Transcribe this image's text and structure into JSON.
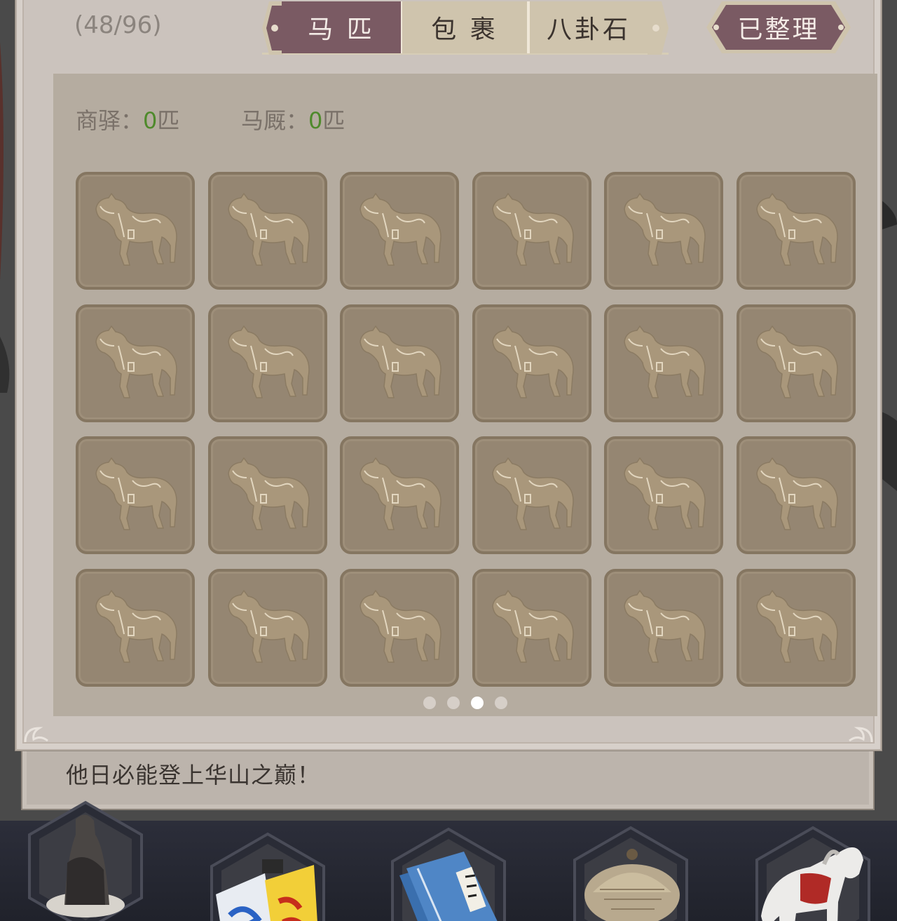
{
  "inventory": {
    "count_label": "(48/96)",
    "tabs": [
      {
        "label": "马 匹",
        "active": true
      },
      {
        "label": "包 裹",
        "active": false
      },
      {
        "label": "八卦石",
        "active": false
      }
    ],
    "sort_button_label": "已整理",
    "stats": [
      {
        "label": "商驿：",
        "value": "0",
        "unit": "匹"
      },
      {
        "label": "马厩：",
        "value": "0",
        "unit": "匹"
      }
    ],
    "slot_icon": "horse-silhouette-icon",
    "slot_count": 24,
    "pages": {
      "total": 4,
      "current": 3
    }
  },
  "dialog": {
    "text": "他日必能登上华山之巅！"
  },
  "bottom_nav": {
    "items": [
      {
        "icon": "character-portrait-icon"
      },
      {
        "icon": "flags-icon"
      },
      {
        "icon": "martial-books-icon"
      },
      {
        "icon": "straw-hat-icon"
      },
      {
        "icon": "white-horse-icon"
      }
    ]
  },
  "colors": {
    "tab_active": "#7a5a63",
    "tab_inactive": "#cfc4ad",
    "stat_number": "#4f8a2c",
    "slot_bg": "#958672"
  }
}
